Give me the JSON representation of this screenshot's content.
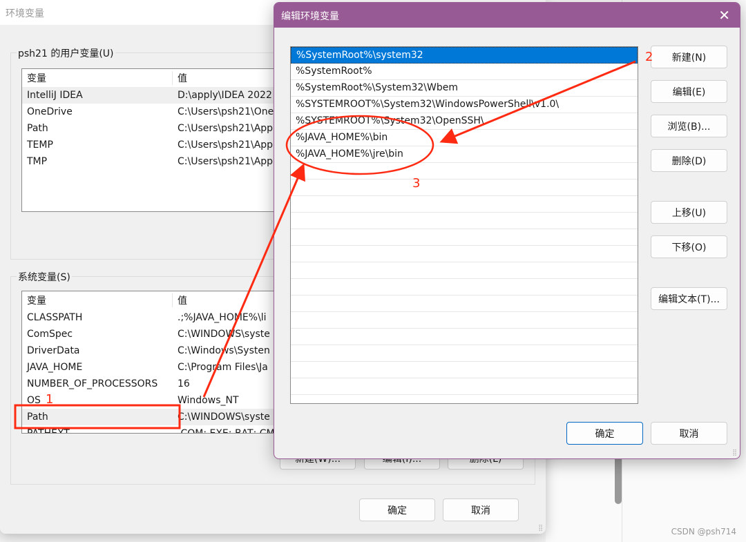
{
  "env_window": {
    "title": "环境变量",
    "user_group": "psh21 的用户变量(U)",
    "headers": [
      "变量",
      "值"
    ],
    "user_vars": [
      [
        "IntelliJ IDEA",
        "D:\\apply\\IDEA 2022"
      ],
      [
        "OneDrive",
        "C:\\Users\\psh21\\One"
      ],
      [
        "Path",
        "C:\\Users\\psh21\\App"
      ],
      [
        "TEMP",
        "C:\\Users\\psh21\\App"
      ],
      [
        "TMP",
        "C:\\Users\\psh21\\App"
      ]
    ],
    "sys_group": "系统变量(S)",
    "sys_vars": [
      [
        "CLASSPATH",
        ".;%JAVA_HOME%\\li"
      ],
      [
        "ComSpec",
        "C:\\WINDOWS\\syste"
      ],
      [
        "DriverData",
        "C:\\Windows\\Systen"
      ],
      [
        "JAVA_HOME",
        "C:\\Program Files\\Ja"
      ],
      [
        "NUMBER_OF_PROCESSORS",
        "16"
      ],
      [
        "OS",
        "Windows_NT"
      ],
      [
        "Path",
        "C:\\WINDOWS\\syste"
      ],
      [
        "PATHEXT",
        ".COM;.EXE;.BAT;.CM"
      ]
    ],
    "sys_buttons": [
      "新建(W)...",
      "编辑(I)...",
      "删除(L)"
    ],
    "ok": "确定",
    "cancel": "取消"
  },
  "edit_dialog": {
    "title": "编辑环境变量",
    "close": "✕",
    "items": [
      "%SystemRoot%\\system32",
      "%SystemRoot%",
      "%SystemRoot%\\System32\\Wbem",
      "%SYSTEMROOT%\\System32\\WindowsPowerShell\\v1.0\\",
      "%SYSTEMROOT%\\System32\\OpenSSH\\",
      "%JAVA_HOME%\\bin",
      "%JAVA_HOME%\\jre\\bin",
      "",
      "",
      "",
      "",
      "",
      "",
      "",
      "",
      "",
      "",
      "",
      "",
      "",
      "",
      ""
    ],
    "buttons": {
      "new": "新建(N)",
      "edit": "编辑(E)",
      "browse": "浏览(B)...",
      "delete": "删除(D)",
      "up": "上移(U)",
      "down": "下移(O)",
      "edit_text": "编辑文本(T)..."
    },
    "ok": "确定",
    "cancel": "取消"
  },
  "annotations": {
    "one": "1",
    "two": "2",
    "three": "3",
    "color": "#ff2a12"
  },
  "watermark": "CSDN @psh714"
}
